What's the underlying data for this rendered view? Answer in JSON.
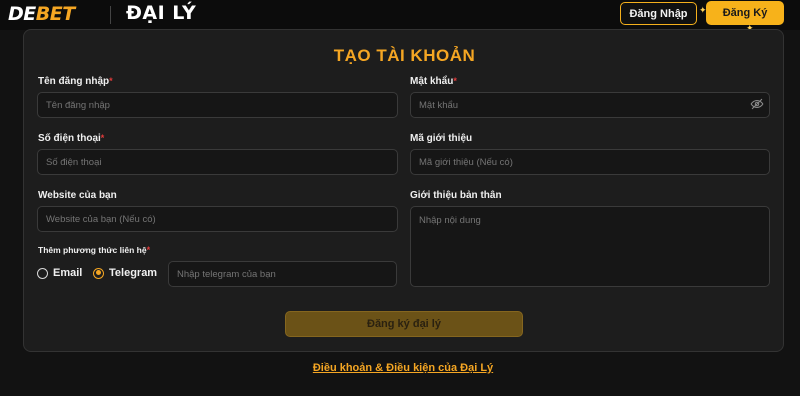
{
  "header": {
    "logo_de": "DE",
    "logo_bet": "BET",
    "section_title": "ĐẠI LÝ",
    "login_label": "Đăng Nhập",
    "register_label": "Đăng Ký"
  },
  "form": {
    "title": "TẠO TÀI KHOẢN",
    "required_mark": "*",
    "username": {
      "label": "Tên đăng nhập",
      "placeholder": "Tên đăng nhập"
    },
    "password": {
      "label": "Mật khẩu",
      "placeholder": "Mật khẩu"
    },
    "phone": {
      "label": "Số điện thoại",
      "placeholder": "Số điện thoại"
    },
    "referral": {
      "label": "Mã giới thiệu",
      "placeholder": "Mã giới thiệu (Nếu có)"
    },
    "website": {
      "label": "Website của bạn",
      "placeholder": "Website của bạn (Nếu có)"
    },
    "bio": {
      "label": "Giới thiệu bản thân",
      "placeholder": "Nhập nội dung"
    },
    "contact": {
      "label": "Thêm phương thức liên hệ",
      "option_email": "Email",
      "option_telegram": "Telegram",
      "selected": "Telegram",
      "telegram_placeholder": "Nhập telegram của bạn"
    },
    "submit_label": "Đăng ký đại lý"
  },
  "footer": {
    "terms_link": "Điều khoản & Điều kiện của Đại Lý"
  },
  "colors": {
    "accent": "#f5a623",
    "background": "#121212",
    "card": "#1d1d1d",
    "required": "#e23b3b"
  },
  "icons": [
    "eye-off-icon",
    "sparkle-icon"
  ]
}
